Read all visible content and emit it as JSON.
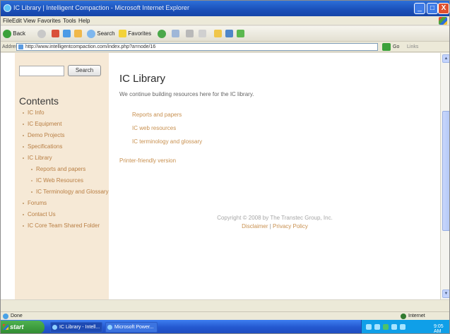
{
  "window": {
    "title": "IC Library | Intelligent Compaction - Microsoft Internet Explorer",
    "minimize": "_",
    "maximize": "□",
    "close": "X"
  },
  "menu": [
    "File",
    "Edit",
    "View",
    "Favorites",
    "Tools",
    "Help"
  ],
  "toolbar": {
    "back": "Back",
    "search": "Search",
    "favorites": "Favorites"
  },
  "address": {
    "label": "Address",
    "url": "http://www.intelligentcompaction.com/index.php?a=node/16",
    "go": "Go",
    "links": "Links"
  },
  "sidebar": {
    "search_button": "Search",
    "contents_title": "Contents",
    "items": [
      {
        "label": "IC Info",
        "level": 1
      },
      {
        "label": "IC Equipment",
        "level": 1
      },
      {
        "label": "Demo Projects",
        "level": 1
      },
      {
        "label": "Specifications",
        "level": 1
      },
      {
        "label": "IC Library",
        "level": 1
      },
      {
        "label": "Reports and papers",
        "level": 2
      },
      {
        "label": "IC Web Resources",
        "level": 2
      },
      {
        "label": "IC Terminology and Glossary",
        "level": 2
      },
      {
        "label": "Forums",
        "level": 1
      },
      {
        "label": "Contact Us",
        "level": 1
      },
      {
        "label": "IC Core Team Shared Folder",
        "level": 1
      }
    ]
  },
  "main": {
    "title": "IC Library",
    "intro": "We continue building resources here for the IC library.",
    "links": [
      "Reports and papers",
      "IC web resources",
      "IC terminology and glossary"
    ],
    "printer_link": "Printer-friendly version",
    "footer": {
      "copyright": "Copyright © 2008 by The Transtec Group, Inc.",
      "disclaimer": "Disclaimer",
      "separator": "|",
      "privacy": "Privacy Policy"
    }
  },
  "status": {
    "left": "Done",
    "zone": "Internet"
  },
  "taskbar": {
    "start": "start",
    "tasks": [
      "IC Library - Intell...",
      "Microsoft Power..."
    ],
    "clock": "9:05 AM"
  },
  "colors": {
    "sidebar_bg": "#f6e9d6",
    "link": "#c8904f",
    "titlebar": "#1a4fb8"
  }
}
